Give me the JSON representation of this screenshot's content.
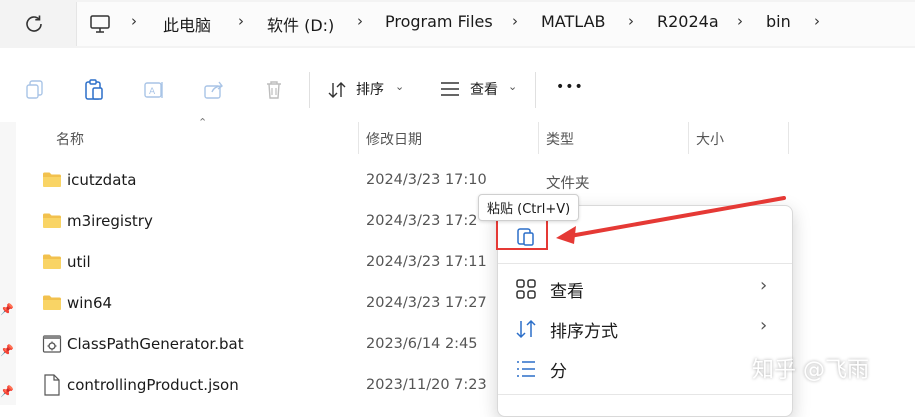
{
  "address": {
    "breadcrumbs": [
      "此电脑",
      "软件 (D:)",
      "Program Files",
      "MATLAB",
      "R2024a",
      "bin"
    ]
  },
  "toolbar": {
    "sort_label": "排序",
    "view_label": "查看",
    "more_label": "•••"
  },
  "columns": {
    "name": "名称",
    "modified": "修改日期",
    "type": "类型",
    "size": "大小"
  },
  "files": [
    {
      "name": "icutzdata",
      "date": "2024/3/23 17:10",
      "type": "文件夹",
      "icon": "folder-icon"
    },
    {
      "name": "m3iregistry",
      "date": "2024/3/23 17:2",
      "type": "",
      "icon": "folder-icon"
    },
    {
      "name": "util",
      "date": "2024/3/23 17:11",
      "type": "",
      "icon": "folder-icon"
    },
    {
      "name": "win64",
      "date": "2024/3/23 17:27",
      "type": "",
      "icon": "folder-icon"
    },
    {
      "name": "ClassPathGenerator.bat",
      "date": "2023/6/14 2:45",
      "type": "",
      "icon": "bat-file-icon"
    },
    {
      "name": "controllingProduct.json",
      "date": "2023/11/20 7:23",
      "type": "",
      "icon": "json-file-icon"
    }
  ],
  "context_menu": {
    "tooltip": "粘贴 (Ctrl+V)",
    "items": [
      {
        "label": "查看",
        "icon": "grid-icon",
        "submenu": true
      },
      {
        "label": "排序方式",
        "icon": "sort-icon",
        "submenu": true
      },
      {
        "label": "分",
        "icon": "group-icon",
        "submenu": false
      }
    ]
  },
  "annotation": {
    "highlight_color": "#e53935"
  },
  "watermark": "知乎 @飞雨"
}
